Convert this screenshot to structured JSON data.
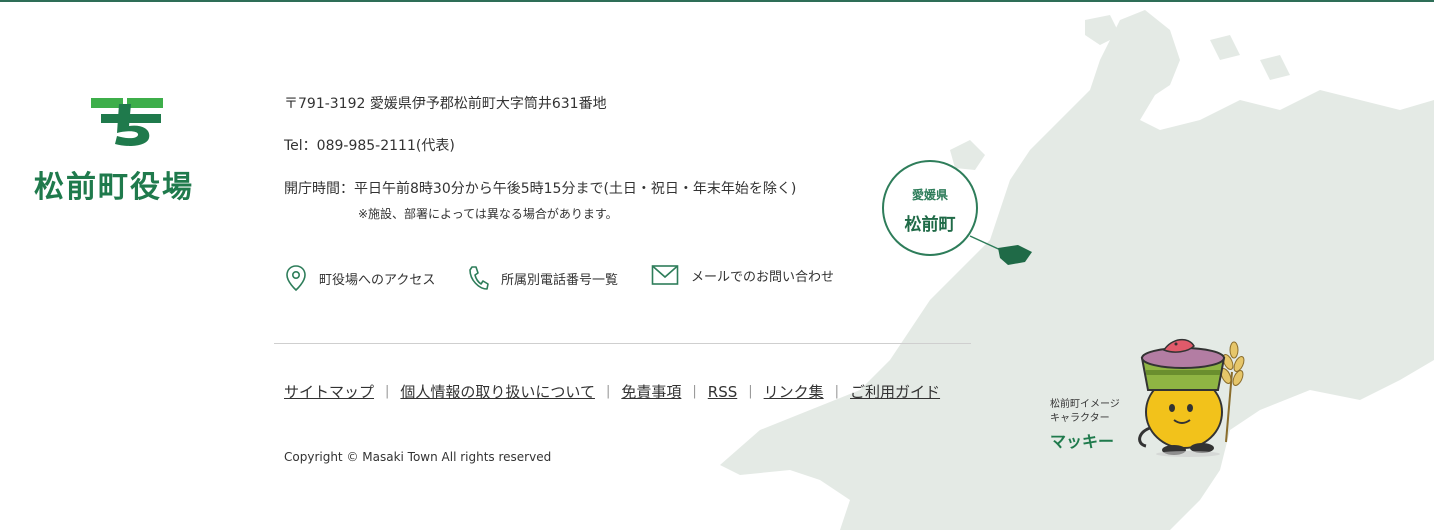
{
  "logo": {
    "text": "松前町役場"
  },
  "info": {
    "address": "〒791-3192 愛媛県伊予郡松前町大字筒井631番地",
    "tel": "Tel：089-985-2111(代表)",
    "hours": "開庁時間：平日午前8時30分から午後5時15分まで(土日・祝日・年末年始を除く)",
    "note": "※施設、部署によっては異なる場合があります。"
  },
  "links": [
    {
      "label": "町役場へのアクセス",
      "icon": "map-pin-icon"
    },
    {
      "label": "所属別電話番号一覧",
      "icon": "phone-icon"
    },
    {
      "label": "メールでのお問い合わせ",
      "icon": "mail-icon"
    }
  ],
  "footer_nav": [
    "サイトマップ",
    "個人情報の取り扱いについて",
    "免責事項",
    "RSS",
    "リンク集",
    "ご利用ガイド"
  ],
  "copyright": "Copyright © Masaki Town All rights reserved",
  "map": {
    "pref": "愛媛県",
    "town": "松前町"
  },
  "character": {
    "line1": "松前町イメージ",
    "line2": "キャラクター",
    "name": "マッキー"
  },
  "colors": {
    "brand": "#1f7a4c",
    "light_green": "#3dae4a",
    "map": "#e3e9e4",
    "top_line": "#2e6e57"
  }
}
